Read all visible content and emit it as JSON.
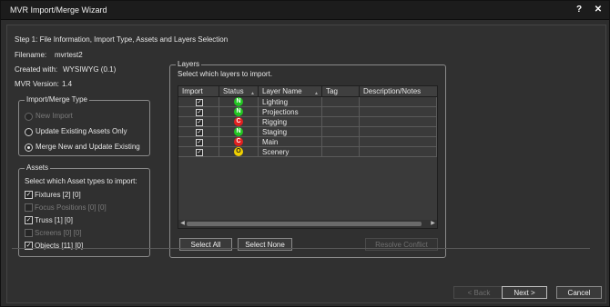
{
  "window": {
    "title": "MVR Import/Merge Wizard",
    "help_glyph": "?",
    "close_glyph": "✕"
  },
  "step": "Step 1: File Information, Import Type, Assets and Layers Selection",
  "info": {
    "filename_label": "Filename:",
    "filename_value": "mvrtest2",
    "created_label": "Created with:",
    "created_value": "WYSIWYG (0.1)",
    "version_label": "MVR Version:",
    "version_value": "1.4"
  },
  "import_type": {
    "title": "Import/Merge Type",
    "options": [
      {
        "label": "New Import",
        "selected": false,
        "enabled": false
      },
      {
        "label": "Update Existing Assets Only",
        "selected": false,
        "enabled": true
      },
      {
        "label": "Merge New and Update Existing",
        "selected": true,
        "enabled": true
      }
    ]
  },
  "assets": {
    "title": "Assets",
    "prompt": "Select which Asset types to import:",
    "items": [
      {
        "label": "Fixtures [2] [0]",
        "checked": true,
        "enabled": true
      },
      {
        "label": "Focus Positions [0] [0]",
        "checked": false,
        "enabled": false
      },
      {
        "label": "Truss [1] [0]",
        "checked": true,
        "enabled": true
      },
      {
        "label": "Screens [0] [0]",
        "checked": false,
        "enabled": false
      },
      {
        "label": "Objects [11] [0]",
        "checked": true,
        "enabled": true
      }
    ]
  },
  "layers": {
    "title": "Layers",
    "prompt": "Select which layers to import.",
    "columns": [
      "Import",
      "Status",
      "Layer Name",
      "Tag",
      "Description/Notes"
    ],
    "rows": [
      {
        "import": true,
        "status": "N",
        "status_color": "#22c422",
        "name": "Lighting",
        "tag": "",
        "notes": ""
      },
      {
        "import": true,
        "status": "N",
        "status_color": "#22c422",
        "name": "Projections",
        "tag": "",
        "notes": ""
      },
      {
        "import": true,
        "status": "C",
        "status_color": "#e02020",
        "name": "Rigging",
        "tag": "",
        "notes": ""
      },
      {
        "import": true,
        "status": "N",
        "status_color": "#22c422",
        "name": "Staging",
        "tag": "",
        "notes": ""
      },
      {
        "import": true,
        "status": "C",
        "status_color": "#e02020",
        "name": "Main",
        "tag": "",
        "notes": ""
      },
      {
        "import": true,
        "status": "O",
        "status_color": "#f0d000",
        "name": "Scenery",
        "tag": "",
        "notes": ""
      }
    ],
    "select_all": "Select All",
    "select_none": "Select None",
    "resolve": "Resolve Conflict"
  },
  "footer": {
    "back": "< Back",
    "next": "Next >",
    "cancel": "Cancel"
  }
}
